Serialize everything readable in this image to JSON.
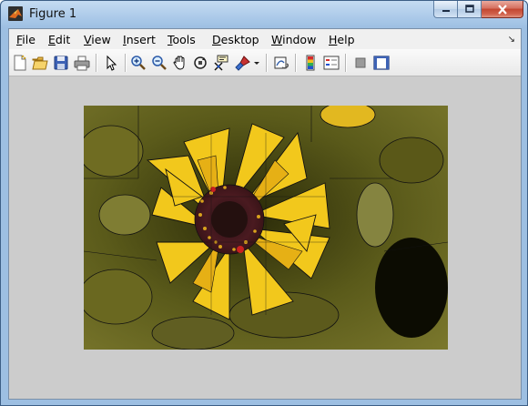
{
  "window": {
    "title": "Figure 1"
  },
  "menu": {
    "items": [
      {
        "key": "F",
        "rest": "ile"
      },
      {
        "key": "E",
        "rest": "dit"
      },
      {
        "key": "V",
        "rest": "iew"
      },
      {
        "key": "I",
        "rest": "nsert"
      },
      {
        "key": "T",
        "rest": "ools"
      },
      {
        "key": "D",
        "rest": "esktop"
      },
      {
        "key": "W",
        "rest": "indow"
      },
      {
        "key": "H",
        "rest": "elp"
      }
    ]
  },
  "toolbar": {
    "icons": [
      "new-figure-icon",
      "open-file-icon",
      "save-icon",
      "print-icon",
      "pointer-icon",
      "zoom-in-icon",
      "zoom-out-icon",
      "pan-hand-icon",
      "rotate-3d-icon",
      "data-cursor-icon",
      "brush-icon",
      "brush-dropdown-icon",
      "link-plot-icon",
      "colorbar-icon",
      "legend-icon",
      "hide-plot-tools-icon",
      "show-plot-tools-icon"
    ]
  },
  "colors": {
    "titlebar": "#a9c8e8",
    "figure_bg": "#cccccc",
    "close_button": "#c34631",
    "flower_petal": "#f2c81c",
    "flower_center": "#3a1418"
  }
}
